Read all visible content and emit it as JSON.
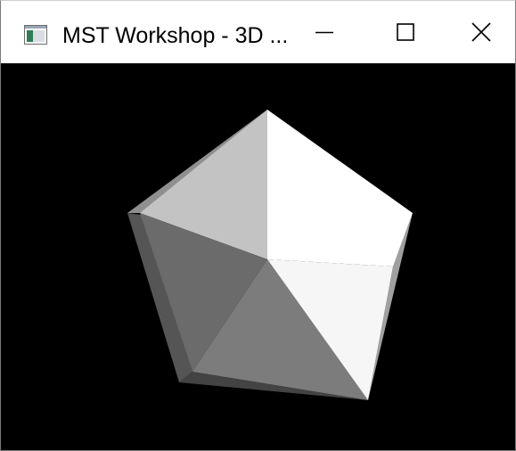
{
  "window": {
    "title": "MST Workshop - 3D ...",
    "controls": {
      "minimize": "minimize-icon",
      "maximize": "maximize-icon",
      "close": "close-icon"
    }
  },
  "viewport": {
    "background": "#000000",
    "model": "pentagon-pyramid",
    "face_colors": {
      "top_right": "#ffffff",
      "top_left": "#c3c3c3",
      "left": "#6b6b6b",
      "bottom": "#7c7c7c",
      "right_lower": "#f6f6f6",
      "edge_left": "#555555",
      "edge_top_left": "#8f8f8f",
      "edge_right": "#a0a0a0"
    }
  }
}
